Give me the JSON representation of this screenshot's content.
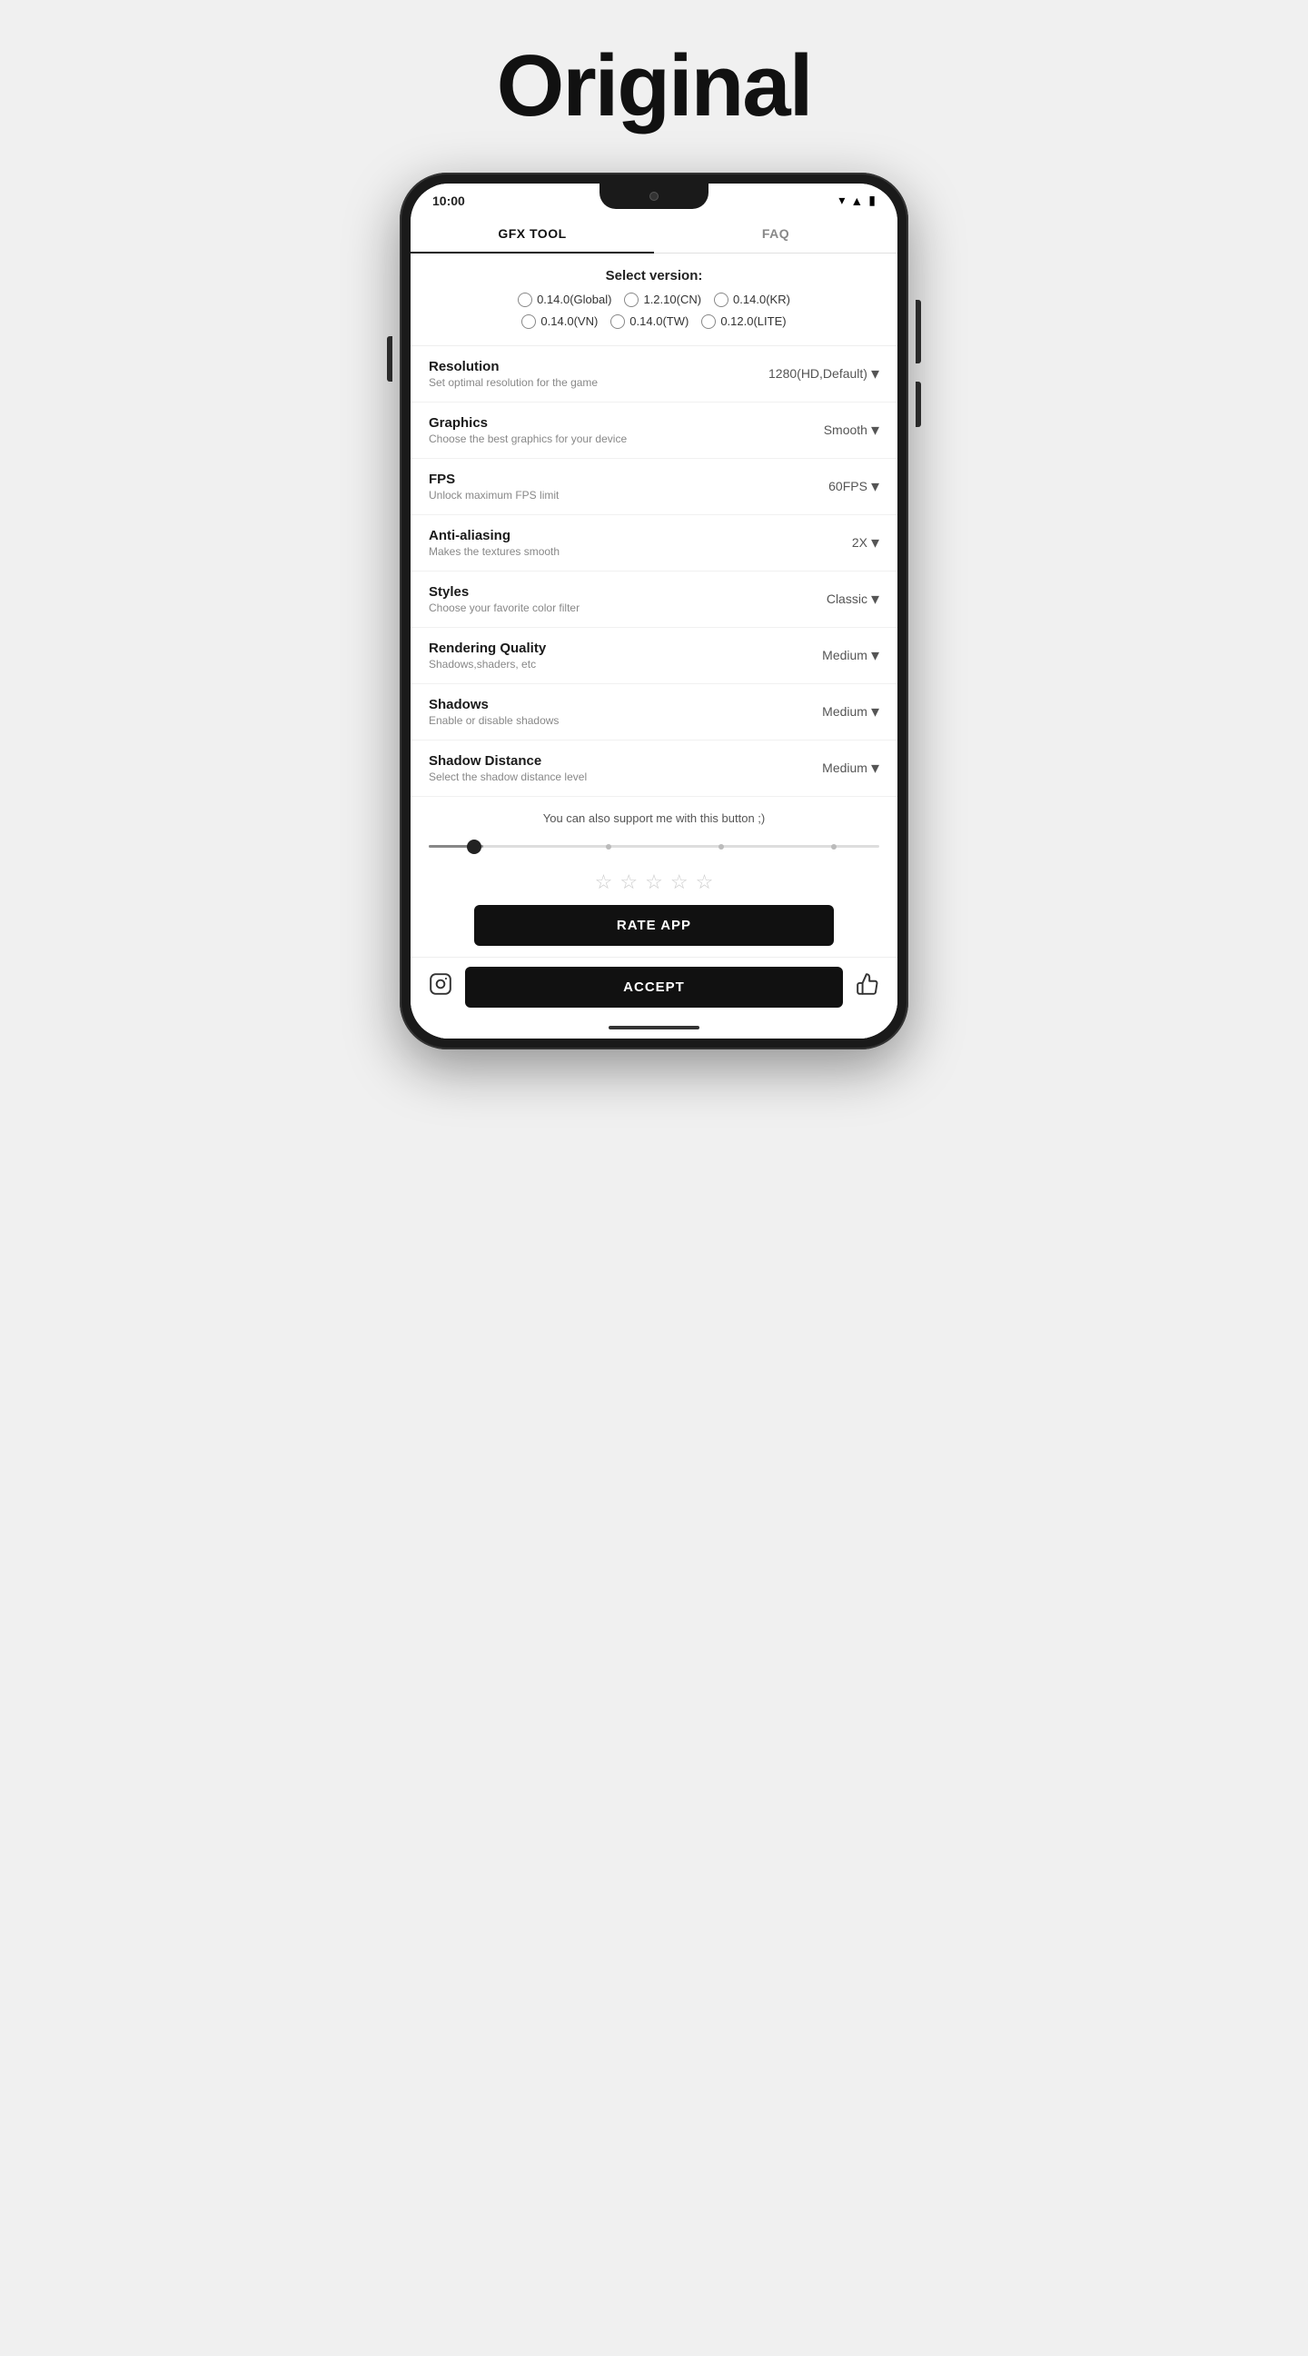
{
  "page": {
    "title": "Original"
  },
  "statusBar": {
    "time": "10:00"
  },
  "tabs": [
    {
      "label": "GFX TOOL",
      "active": true
    },
    {
      "label": "FAQ",
      "active": false
    }
  ],
  "selectVersion": {
    "title": "Select version:",
    "options": [
      {
        "label": "0.14.0(Global)"
      },
      {
        "label": "1.2.10(CN)"
      },
      {
        "label": "0.14.0(KR)"
      },
      {
        "label": "0.14.0(VN)"
      },
      {
        "label": "0.14.0(TW)"
      },
      {
        "label": "0.12.0(LITE)"
      }
    ]
  },
  "settings": [
    {
      "label": "Resolution",
      "desc": "Set optimal resolution for the game",
      "value": "1280(HD,Default)"
    },
    {
      "label": "Graphics",
      "desc": "Choose the best graphics for your device",
      "value": "Smooth"
    },
    {
      "label": "FPS",
      "desc": "Unlock maximum FPS limit",
      "value": "60FPS"
    },
    {
      "label": "Anti-aliasing",
      "desc": "Makes the textures smooth",
      "value": "2X"
    },
    {
      "label": "Styles",
      "desc": "Choose your favorite color filter",
      "value": "Classic"
    },
    {
      "label": "Rendering Quality",
      "desc": "Shadows,shaders, etc",
      "value": "Medium"
    },
    {
      "label": "Shadows",
      "desc": "Enable or disable shadows",
      "value": "Medium"
    },
    {
      "label": "Shadow Distance",
      "desc": "Select the shadow distance level",
      "value": "Medium"
    }
  ],
  "support": {
    "text": "You can also support me with this button ;)"
  },
  "rateApp": {
    "label": "RATE APP"
  },
  "acceptBtn": {
    "label": "ACCEPT"
  },
  "stars": [
    "★",
    "★",
    "★",
    "★",
    "★"
  ]
}
